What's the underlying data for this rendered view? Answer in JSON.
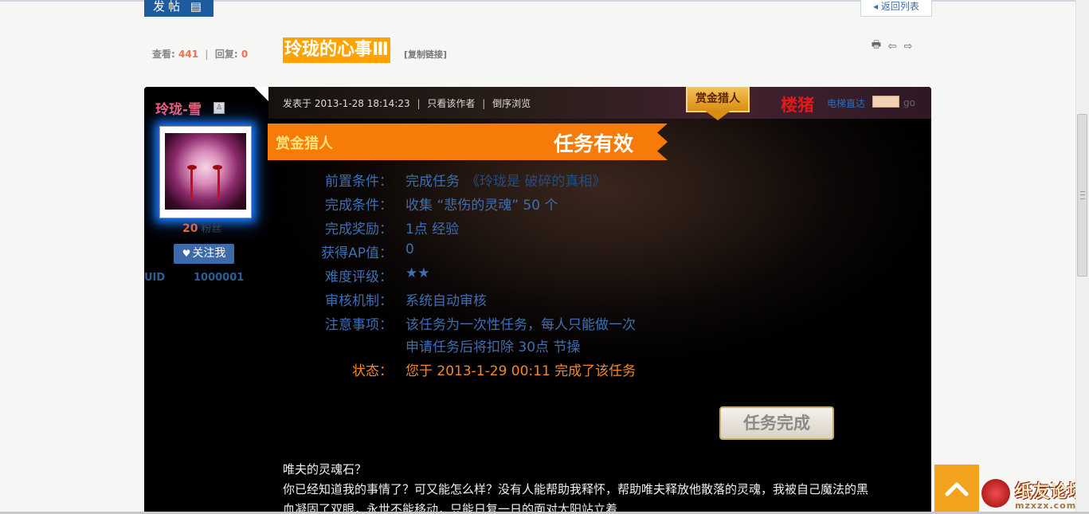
{
  "toolbar": {
    "post_button": "发帖",
    "post_button_icon": "document-icon",
    "back_to_list": "返回列表",
    "back_icon": "triangle-left-icon"
  },
  "stats": {
    "views_label": "查看:",
    "views": "441",
    "sep": "|",
    "replies_label": "回复:",
    "replies": "0"
  },
  "thread": {
    "title": "玲珑的心事Ⅲ",
    "copy_link": "[复制链接]",
    "icons": [
      "print-icon",
      "prev-arrow-icon",
      "next-arrow-icon"
    ]
  },
  "author": {
    "name": "玲珑-雪",
    "fans_count": "20",
    "fans_label": "粉丝",
    "follow_label": "关注我",
    "uid_label": "UID",
    "uid": "1000001"
  },
  "post": {
    "posted_at": "发表于 2013-1-28 18:14:23",
    "author_only": "只看该作者",
    "reverse": "倒序浏览",
    "sep": "|",
    "badge": "赏金猎人",
    "floor": "楼猪",
    "elevator": "电梯直达",
    "go": "go"
  },
  "quest": {
    "type": "赏金猎人",
    "validity": "任务有效",
    "rows": [
      {
        "label": "前置条件：",
        "value": "完成任务",
        "value2": "《玲珑是 破碎的真相》"
      },
      {
        "label": "完成条件：",
        "value": "收集 “悲伤的灵魂” 50 个"
      },
      {
        "label": "完成奖励：",
        "value": "1点 经验"
      },
      {
        "label": "获得AP值：",
        "value": "0"
      },
      {
        "label": "难度评级：",
        "value": "★★"
      },
      {
        "label": "审核机制：",
        "value": "系统自动审核"
      },
      {
        "label": "注意事项：",
        "value": "该任务为一次性任务，每人只能做一次"
      },
      {
        "label": "",
        "value": "申请任务后将扣除 30点 节操"
      },
      {
        "label": "状态：",
        "value": "您于 2013-1-29 00:11 完成了该任务"
      }
    ],
    "complete_button": "任务完成"
  },
  "body": {
    "line1": "唯夫的灵魂石？",
    "line2": "你已经知道我的事情了？可又能怎么样？没有人能帮助我释怀，帮助唯夫释放他散落的灵魂，我被自己魔法的黑",
    "line3": "血凝固了双眼，永世不能移动，只能日复一日的面对太阳站立着"
  },
  "watermark": {
    "text": "纸友论坛",
    "url": "mzxzx.com"
  },
  "colors": {
    "accent_orange": "#f77b08",
    "title_bg": "#ffa300",
    "link_blue": "#3f6fb1",
    "floor_red": "#e61717"
  }
}
